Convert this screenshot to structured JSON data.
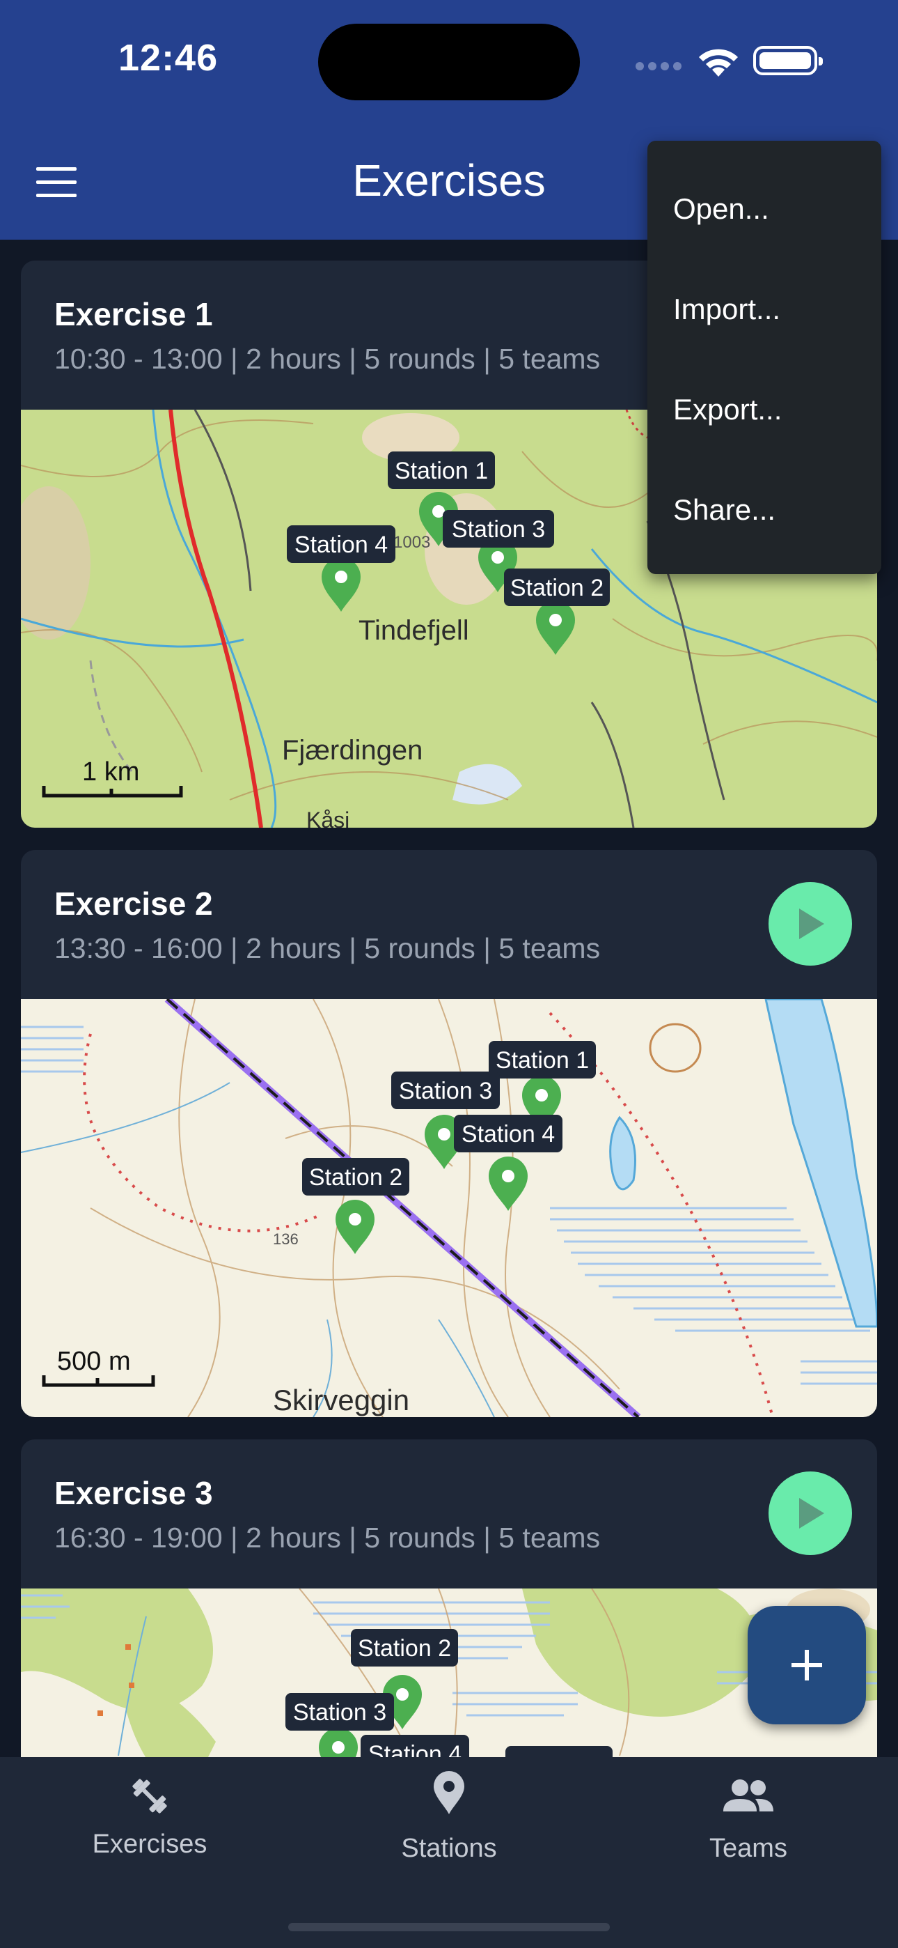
{
  "status_bar": {
    "time": "12:46"
  },
  "app_bar": {
    "title": "Exercises"
  },
  "exercises": [
    {
      "title": "Exercise 1",
      "subtitle": "10:30 - 13:00 | 2 hours | 5 rounds | 5 teams",
      "map": {
        "labels": [
          "Tindefjell",
          "Fjærdingen",
          "Kåsi",
          "1003"
        ],
        "scale": "1 km",
        "stations": [
          "Station 1",
          "Station 3",
          "Station 4",
          "Station 2"
        ]
      }
    },
    {
      "title": "Exercise 2",
      "subtitle": "13:30 - 16:00 | 2 hours | 5 rounds | 5 teams",
      "map": {
        "labels": [
          "Skirveggin",
          "136"
        ],
        "scale": "500 m",
        "stations": [
          "Station 1",
          "Station 3",
          "Station 4",
          "Station 2"
        ]
      }
    },
    {
      "title": "Exercise 3",
      "subtitle": "16:30 - 19:00 | 2 hours | 5 rounds | 5 teams",
      "map": {
        "stations": [
          "Station 2",
          "Station 3",
          "Station 4"
        ]
      }
    }
  ],
  "menu": {
    "items": [
      "Open...",
      "Import...",
      "Export...",
      "Share..."
    ]
  },
  "bottom_nav": {
    "items": [
      {
        "label": "Exercises",
        "icon": "dumbbell-icon"
      },
      {
        "label": "Stations",
        "icon": "location-pin-icon"
      },
      {
        "label": "Teams",
        "icon": "group-icon"
      }
    ]
  },
  "colors": {
    "app_bar": "#25418f",
    "background": "#111826",
    "card": "#1f2838",
    "accent_play": "#69ebab",
    "fab": "#234b80",
    "marker": "#4caf50"
  }
}
